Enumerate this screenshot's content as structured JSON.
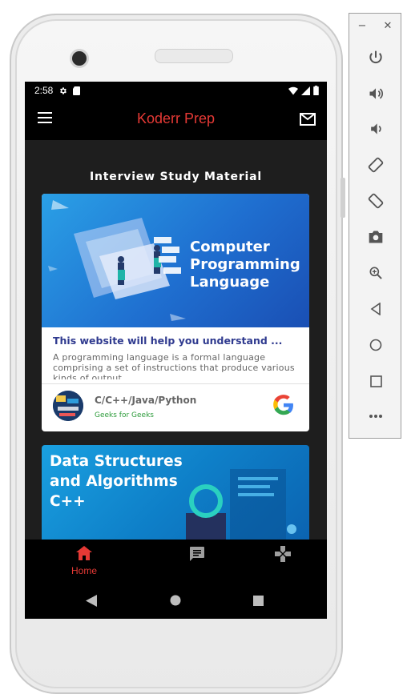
{
  "status": {
    "time": "2:58"
  },
  "app": {
    "title": "Koderr Prep"
  },
  "section": {
    "title": "Interview Study Material"
  },
  "cards": [
    {
      "banner_text": "Computer Programming Language",
      "banner_lines": [
        "Computer",
        "Programming",
        "Language"
      ],
      "headline": "This website will help you understand ...",
      "description": "A programming language is a formal language comprising a set of instructions that produce various kinds of output.",
      "source_title": "C/C++/Java/Python",
      "source_name": "Geeks for Geeks"
    },
    {
      "banner_lines": [
        "Data Structures",
        "and Algorithms",
        "C++"
      ]
    }
  ],
  "bottom_nav": [
    {
      "label": "Home",
      "icon": "home-icon",
      "active": true
    },
    {
      "label": "",
      "icon": "chat-icon",
      "active": false
    },
    {
      "label": "",
      "icon": "gamepad-icon",
      "active": false
    }
  ],
  "colors": {
    "accent": "#e53935",
    "appbar": "#000000",
    "background": "#1e1e1e",
    "headline": "#2f3a8f"
  },
  "emulator_toolbar": {
    "top": [
      "minimize-icon",
      "close-icon"
    ],
    "buttons": [
      "power-icon",
      "volume-up-icon",
      "volume-down-icon",
      "rotate-left-icon",
      "rotate-right-icon",
      "camera-icon",
      "zoom-icon",
      "back-icon",
      "home-circle-icon",
      "overview-icon",
      "more-icon"
    ]
  }
}
